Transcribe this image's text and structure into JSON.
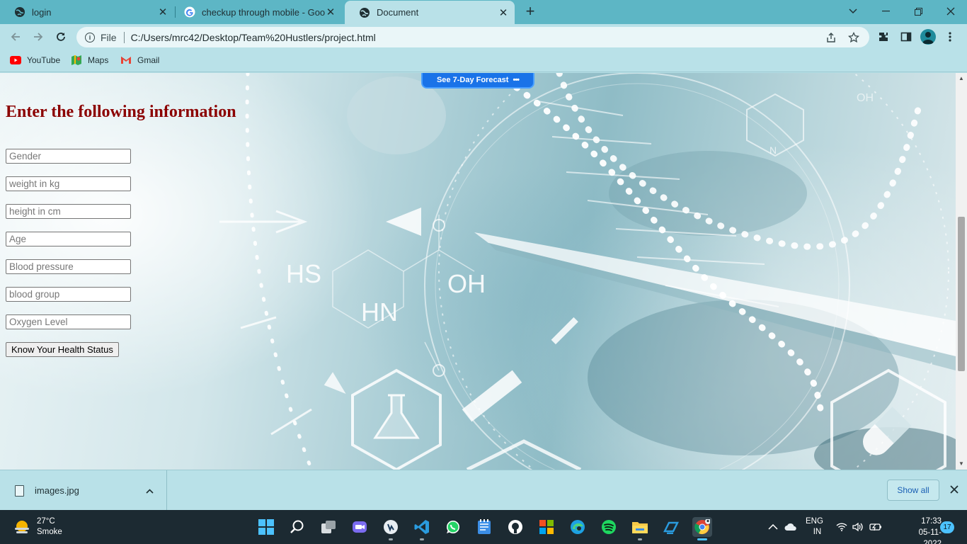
{
  "browser": {
    "tabs": [
      {
        "title": "login",
        "active": false
      },
      {
        "title": "checkup through mobile - Google Search",
        "active": false
      },
      {
        "title": "Document",
        "active": true
      }
    ],
    "address_scheme": "File",
    "address_url": "C:/Users/mrc42/Desktop/Team%20Hustlers/project.html",
    "bookmarks": [
      {
        "label": "YouTube",
        "icon": "youtube-icon"
      },
      {
        "label": "Maps",
        "icon": "maps-icon"
      },
      {
        "label": "Gmail",
        "icon": "gmail-icon"
      }
    ]
  },
  "page": {
    "forecast_label": "See 7-Day Forecast",
    "heading": "Enter the following information",
    "fields": [
      {
        "placeholder": "Gender"
      },
      {
        "placeholder": "weight in kg"
      },
      {
        "placeholder": "height in cm"
      },
      {
        "placeholder": "Age"
      },
      {
        "placeholder": "Blood pressure"
      },
      {
        "placeholder": "blood group"
      },
      {
        "placeholder": "Oxygen Level"
      }
    ],
    "submit_label": "Know Your Health Status",
    "background_text": {
      "hs": "HS",
      "oh": "OH",
      "hn": "HN",
      "n": "N",
      "oh_small": "OH"
    }
  },
  "downloads": {
    "file_name": "images.jpg",
    "show_all_label": "Show all"
  },
  "taskbar": {
    "weather_temp": "27°C",
    "weather_desc": "Smoke",
    "language": "ENG",
    "region": "IN",
    "time": "17:33",
    "date": "05-11-2022",
    "notification_count": "17",
    "apps": [
      "start-icon",
      "search-icon",
      "task-view-icon",
      "chat-icon",
      "app-icon",
      "vscode-icon",
      "whatsapp-icon",
      "notes-icon",
      "github-icon",
      "office-icon",
      "edge-icon",
      "spotify-icon",
      "file-explorer-icon",
      "remote-icon",
      "chrome-icon"
    ]
  },
  "colors": {
    "tab_strip": "#5db6c5",
    "toolbar": "#b9e1e8",
    "heading": "#8b0000",
    "taskbar": "#1c2a32",
    "accent": "#4cc2ff"
  }
}
